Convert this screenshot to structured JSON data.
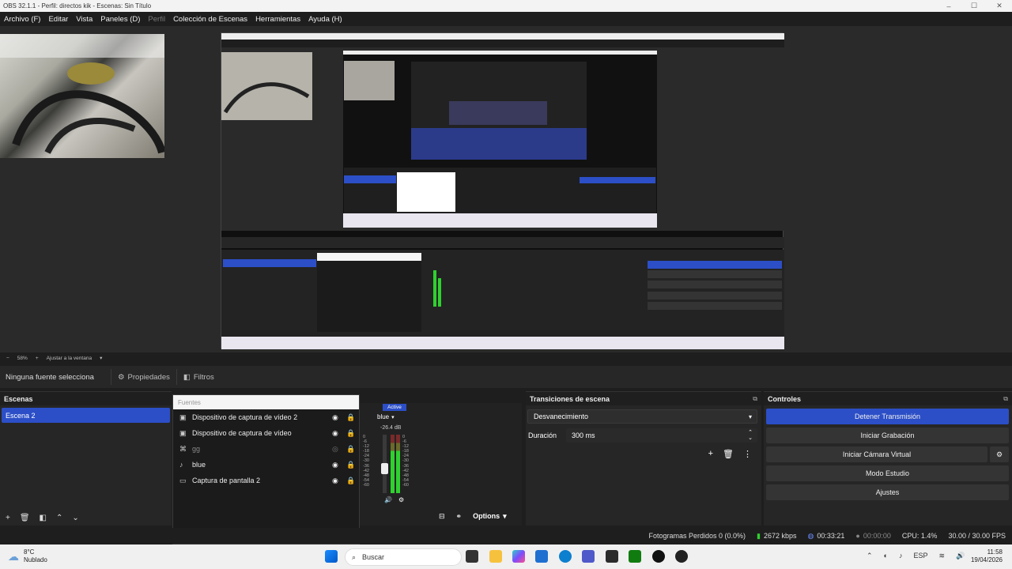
{
  "window": {
    "title": "OBS 32.1.1 - Perfil: directos kik - Escenas: Sin Título"
  },
  "menu": [
    "Archivo (F)",
    "Editar",
    "Vista",
    "Paneles (D)",
    "Perfil",
    "Colección de Escenas",
    "Herramientas",
    "Ayuda (H)"
  ],
  "zoom": {
    "value": "58%",
    "fit": "Ajustar a la ventana"
  },
  "props_row": {
    "label": "Ninguna fuente selecciona",
    "properties": "Propiedades",
    "filters": "Filtros"
  },
  "scenes": {
    "title": "Escenas",
    "items": [
      "Escena 2"
    ]
  },
  "sources": {
    "title": "Fuentes",
    "items": [
      {
        "icon": "camera-icon",
        "label": "Dispositivo de captura de vídeo 2"
      },
      {
        "icon": "camera-icon",
        "label": "Dispositivo de captura de vídeo"
      },
      {
        "icon": "game-icon",
        "label": "gg"
      },
      {
        "icon": "mic-icon",
        "label": "blue"
      },
      {
        "icon": "monitor-icon",
        "label": "Captura de pantalla 2"
      }
    ]
  },
  "mixer": {
    "active": "Active",
    "channel": "blue",
    "level": "-26.4 dB",
    "ticks": [
      "0",
      "-6",
      "-12",
      "-18",
      "-24",
      "-30",
      "-36",
      "-42",
      "-48",
      "-54",
      "-60"
    ],
    "options": "Options"
  },
  "transitions": {
    "title": "Transiciones de escena",
    "selected": "Desvanecimiento",
    "duration_label": "Duración",
    "duration_value": "300 ms"
  },
  "controls": {
    "title": "Controles",
    "buttons": [
      "Detener Transmisión",
      "Iniciar Grabación",
      "Iniciar Cámara Virtual",
      "Modo Estudio",
      "Ajustes"
    ]
  },
  "status": {
    "dropped": "Fotogramas Perdidos 0 (0.0%)",
    "bitrate": "2672 kbps",
    "stream_time": "00:33:21",
    "rec_time": "00:00:00",
    "cpu": "CPU: 1.4%",
    "fps": "30.00 / 30.00 FPS"
  },
  "taskbar": {
    "weather_temp": "8°C",
    "weather_desc": "Nublado",
    "search": "Buscar",
    "lang": "ESP",
    "time": "11:58",
    "date": "19/04/2026"
  },
  "colors": {
    "accent": "#2c4fc7",
    "bg": "#1e1e1e",
    "meter_green": "#2fd12f"
  }
}
